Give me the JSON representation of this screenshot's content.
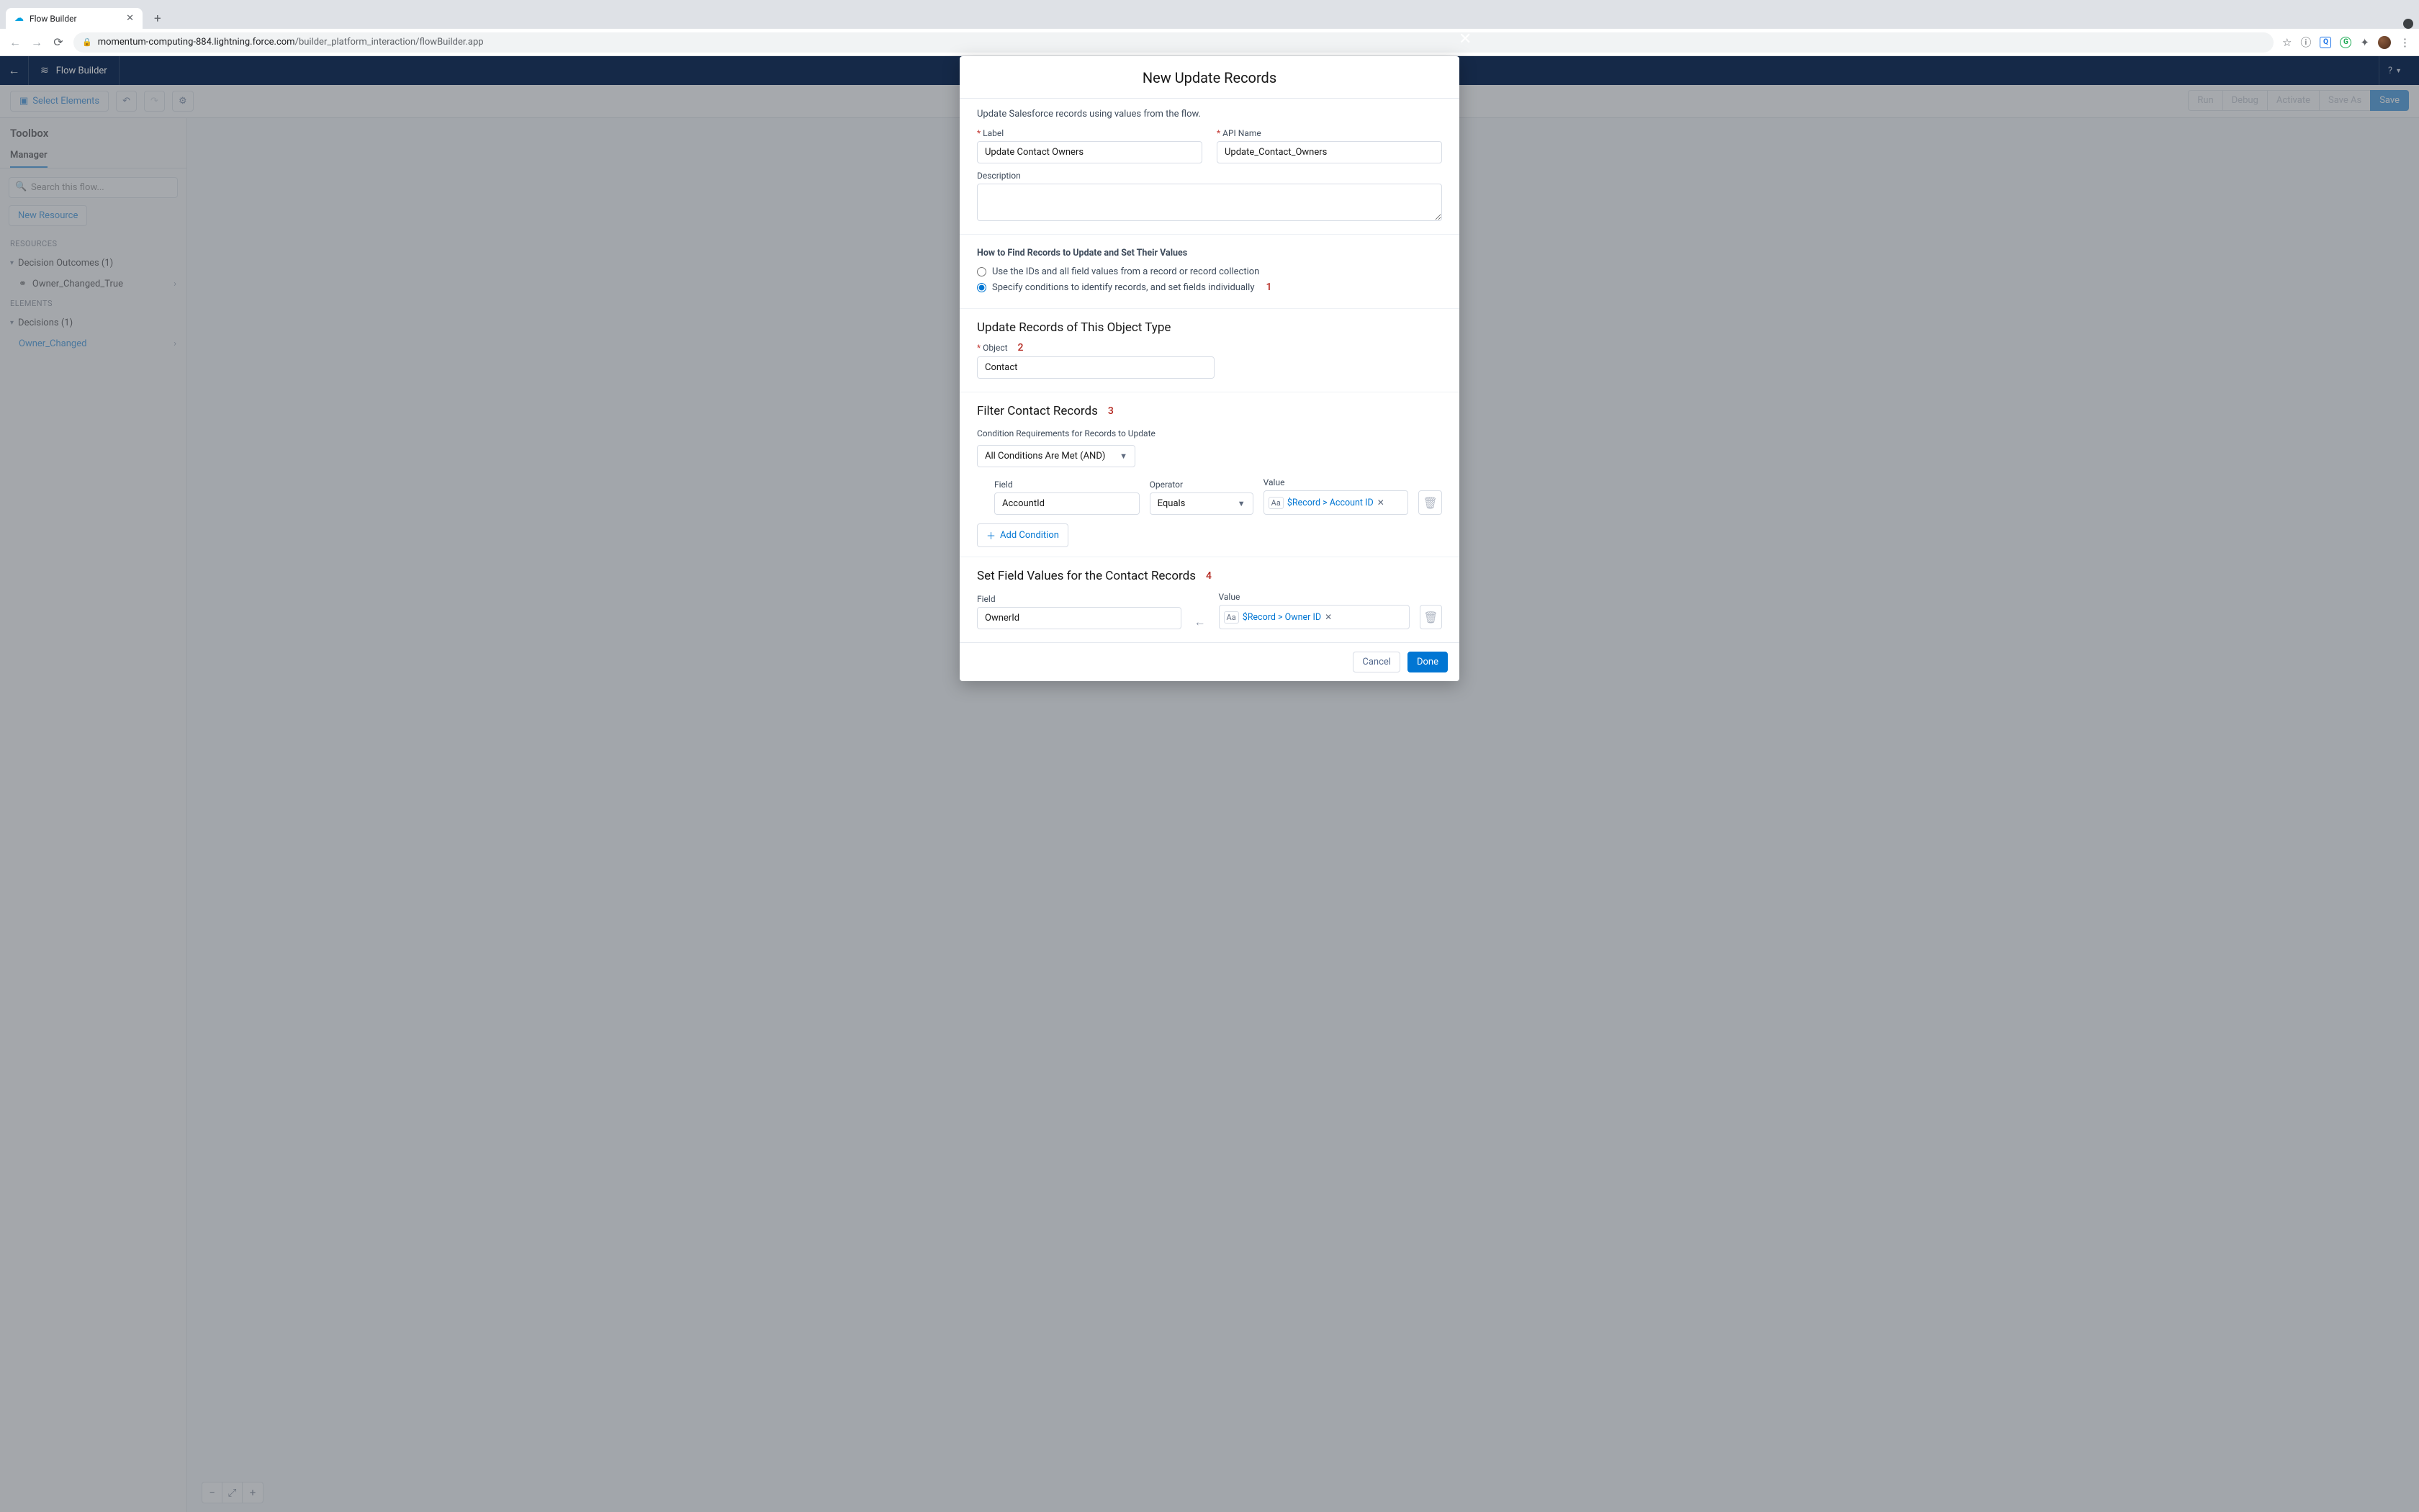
{
  "browser": {
    "tab_title": "Flow Builder",
    "url_host": "momentum-computing-884.lightning.force.com",
    "url_path": "/builder_platform_interaction/flowBuilder.app"
  },
  "appbar": {
    "title": "Flow Builder",
    "help": "?"
  },
  "toolbar": {
    "select_elements": "Select Elements",
    "run": "Run",
    "debug": "Debug",
    "activate": "Activate",
    "save_as": "Save As",
    "save": "Save"
  },
  "sidebar": {
    "title": "Toolbox",
    "tab": "Manager",
    "search_placeholder": "Search this flow...",
    "new_resource": "New Resource",
    "resources_head": "RESOURCES",
    "decision_outcomes": "Decision Outcomes (1)",
    "outcome_item": "Owner_Changed_True",
    "elements_head": "ELEMENTS",
    "decisions": "Decisions (1)",
    "decision_item": "Owner_Changed"
  },
  "modal": {
    "title": "New Update Records",
    "helper": "Update Salesforce records using values from the flow.",
    "label_label": "Label",
    "label_value": "Update Contact Owners",
    "api_label": "API Name",
    "api_value": "Update_Contact_Owners",
    "desc_label": "Description",
    "howto_head": "How to Find Records to Update and Set Their Values",
    "radio1": "Use the IDs and all field values from a record or record collection",
    "radio2": "Specify conditions to identify records, and set fields individually",
    "anno1": "1",
    "object_section": "Update Records of This Object Type",
    "object_label": "Object",
    "object_value": "Contact",
    "anno2": "2",
    "filter_section": "Filter Contact Records",
    "anno3": "3",
    "cond_req_label": "Condition Requirements for Records to Update",
    "cond_req_value": "All Conditions Are Met (AND)",
    "field_head": "Field",
    "operator_head": "Operator",
    "value_head": "Value",
    "filter_field": "AccountId",
    "filter_op": "Equals",
    "filter_value": "$Record > Account ID",
    "add_condition": "Add Condition",
    "set_section": "Set Field Values for the Contact Records",
    "anno4": "4",
    "set_field": "OwnerId",
    "set_value": "$Record > Owner ID",
    "cancel": "Cancel",
    "done": "Done"
  }
}
